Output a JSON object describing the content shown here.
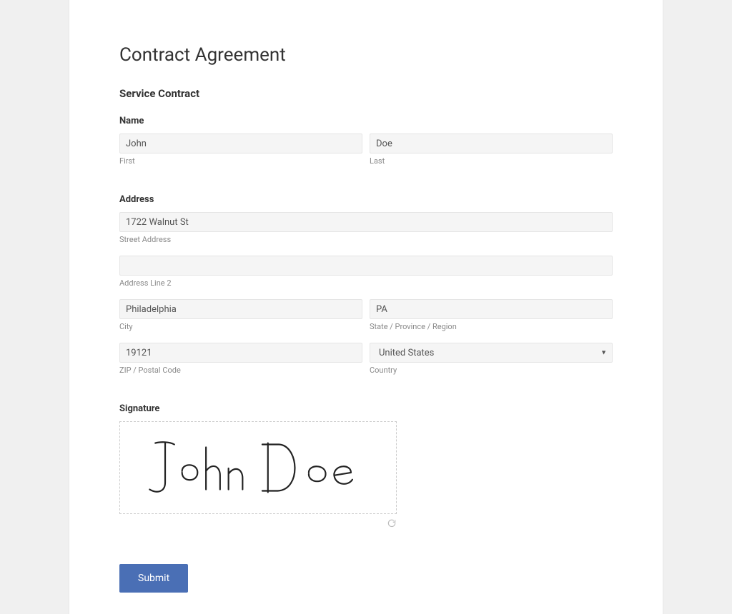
{
  "page": {
    "title": "Contract Agreement",
    "section_title": "Service Contract"
  },
  "name": {
    "label": "Name",
    "first": {
      "value": "John",
      "sub": "First"
    },
    "last": {
      "value": "Doe",
      "sub": "Last"
    }
  },
  "address": {
    "label": "Address",
    "street": {
      "value": "1722 Walnut St",
      "sub": "Street Address"
    },
    "line2": {
      "value": "",
      "sub": "Address Line 2"
    },
    "city": {
      "value": "Philadelphia",
      "sub": "City"
    },
    "state": {
      "value": "PA",
      "sub": "State / Province / Region"
    },
    "zip": {
      "value": "19121",
      "sub": "ZIP / Postal Code"
    },
    "country": {
      "value": "United States",
      "sub": "Country"
    }
  },
  "signature": {
    "label": "Signature",
    "signed_text": "John Doe"
  },
  "actions": {
    "submit": "Submit"
  }
}
